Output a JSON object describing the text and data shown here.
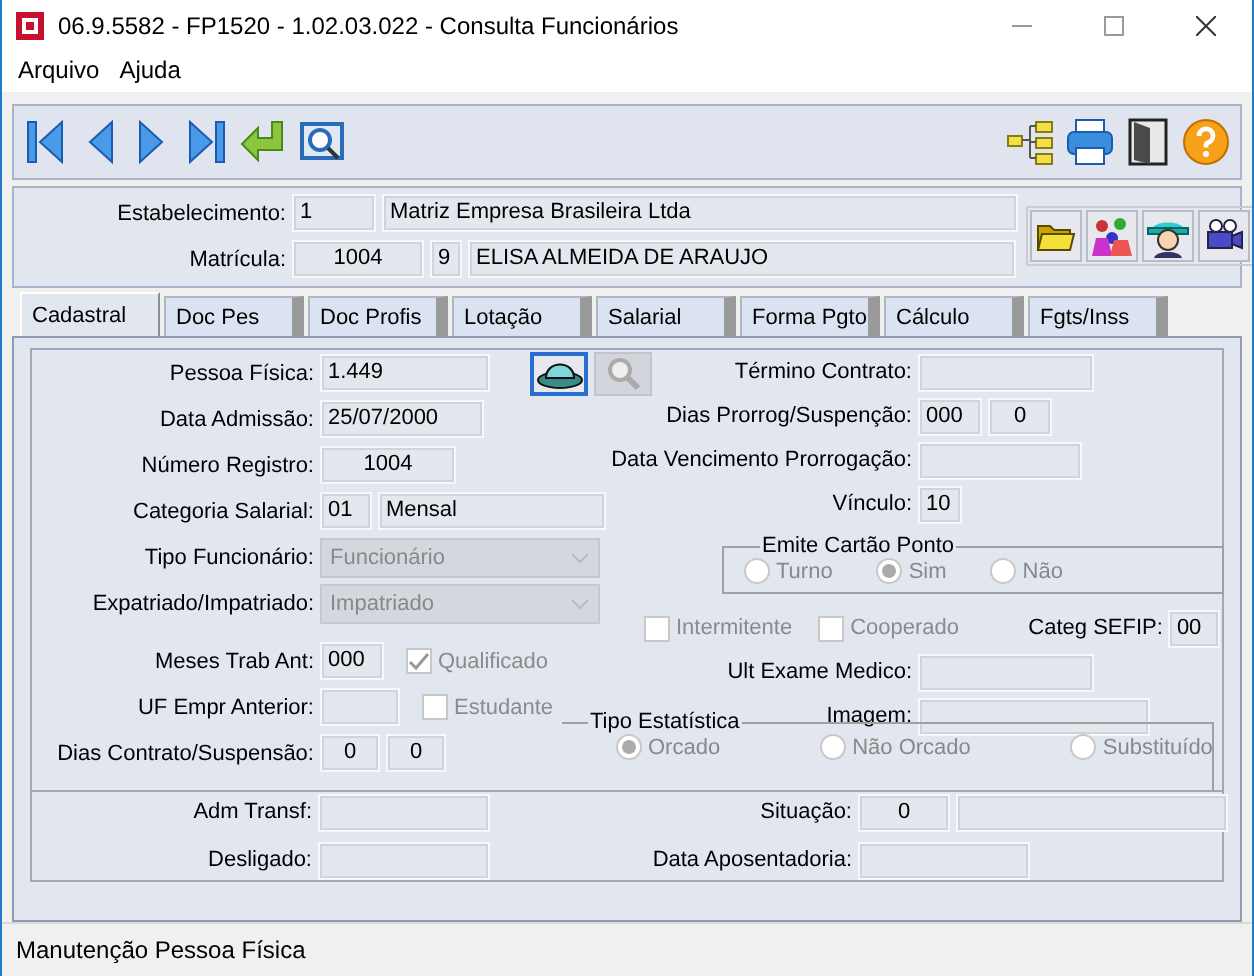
{
  "window": {
    "title": "06.9.5582 - FP1520 - 1.02.03.022 - Consulta Funcionários"
  },
  "menu": [
    {
      "label": "Arquivo"
    },
    {
      "label": "Ajuda"
    }
  ],
  "header": {
    "rows": [
      {
        "label": "Estabelecimento:",
        "values": [
          "1",
          "Matriz Empresa Brasileira Ltda"
        ]
      },
      {
        "label": "Matrícula:",
        "values": [
          "1004",
          "9",
          "ELISA ALMEIDA DE ARAUJO"
        ]
      }
    ]
  },
  "tabs": [
    {
      "label": "Cadastral",
      "selected": true
    },
    {
      "label": "Doc Pes",
      "selected": false
    },
    {
      "label": "Doc Profis",
      "selected": false
    },
    {
      "label": "Lotação",
      "selected": false
    },
    {
      "label": "Salarial",
      "selected": false
    },
    {
      "label": "Forma Pgto",
      "selected": false
    },
    {
      "label": "Cálculo",
      "selected": false
    },
    {
      "label": "Fgts/Inss",
      "selected": false
    }
  ],
  "left": [
    {
      "kind": "lookup",
      "label": "Pessoa Física:",
      "values": [
        "1.449"
      ]
    },
    {
      "kind": "field",
      "label": "Data Admissão:",
      "values": [
        "25/07/2000"
      ]
    },
    {
      "kind": "field",
      "label": "Número Registro:",
      "values": [
        "1004"
      ]
    },
    {
      "kind": "field",
      "label": "Categoria Salarial:",
      "values": [
        "01",
        "Mensal"
      ]
    },
    {
      "kind": "select",
      "label": "Tipo Funcionário:",
      "value": "Funcionário",
      "disabled": true
    },
    {
      "kind": "select",
      "label": "Expatriado/Impatriado:",
      "value": "Impatriado",
      "disabled": true
    },
    {
      "kind": "field",
      "label": "Meses Trab Ant:",
      "values": [
        "000"
      ],
      "checkbox": {
        "label": "Qualificado",
        "checked": true,
        "disabled": true
      }
    },
    {
      "kind": "field",
      "label": "UF Empr Anterior:",
      "checkbox": {
        "label": "Estudante",
        "checked": false,
        "disabled": true
      }
    },
    {
      "kind": "field",
      "label": "Dias Contrato/Suspensão:",
      "values": [
        "0",
        "0"
      ]
    }
  ],
  "right": [
    {
      "kind": "field",
      "label": "Término Contrato:"
    },
    {
      "kind": "field",
      "label": "Dias Prorrog/Suspenção:",
      "values": [
        "000",
        "0"
      ]
    },
    {
      "kind": "field",
      "label": "Data Vencimento Prorrogação:"
    },
    {
      "kind": "field",
      "label": "Vínculo:",
      "values": [
        "10"
      ]
    },
    {
      "kind": "radio_group",
      "title": "Emite Cartão Ponto",
      "disabled": true,
      "options": [
        {
          "label": "Turno",
          "selected": false
        },
        {
          "label": "Sim",
          "selected": true
        },
        {
          "label": "Não",
          "selected": false
        }
      ]
    },
    {
      "kind": "checks",
      "checkboxes": [
        {
          "label": "Intermitente",
          "checked": false,
          "disabled": true
        },
        {
          "label": "Cooperado",
          "checked": false,
          "disabled": true
        }
      ],
      "field": {
        "label": "Categ SEFIP:",
        "values": [
          "00"
        ]
      }
    },
    {
      "kind": "field",
      "label": "Ult Exame Medico:"
    },
    {
      "kind": "field",
      "label": "Imagem:"
    },
    {
      "kind": "radio_group",
      "title": "Tipo Estatística",
      "disabled": true,
      "options": [
        {
          "label": "Orcado",
          "selected": true
        },
        {
          "label": "Não Orcado",
          "selected": false
        },
        {
          "label": "Substituído",
          "selected": false
        }
      ]
    }
  ],
  "bottom": [
    {
      "label": "Adm Transf:"
    },
    {
      "label": "Situação:",
      "values": [
        "0"
      ]
    },
    {
      "label": "Desligado:"
    },
    {
      "label": "Data Aposentadoria:"
    }
  ],
  "status_bar": {
    "text": "Manutenção Pessoa Física"
  }
}
